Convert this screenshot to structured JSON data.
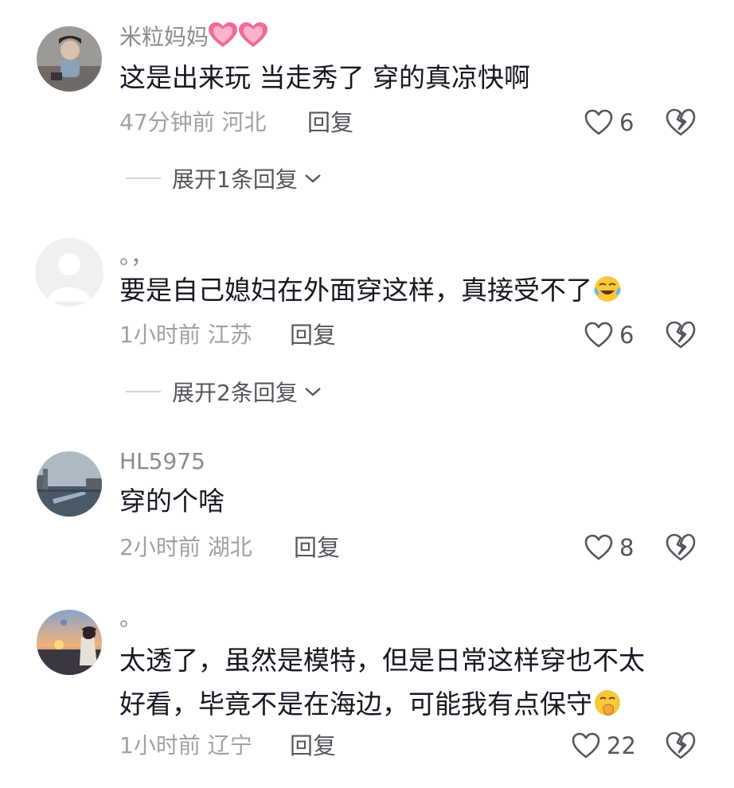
{
  "comments": [
    {
      "username": "米粒妈妈",
      "username_emoji": "pink-hearts",
      "text": "这是出来玩 当走秀了 穿的真凉快啊",
      "time": "47分钟前",
      "location": "河北",
      "reply_label": "回复",
      "likes": "6",
      "expand_label": "展开1条回复"
    },
    {
      "username": "。，",
      "text": "要是自己媳妇在外面穿这样，真接受不了",
      "text_emoji": "crying-laughing",
      "time": "1小时前",
      "location": "江苏",
      "reply_label": "回复",
      "likes": "6",
      "expand_label": "展开2条回复"
    },
    {
      "username": "HL5975",
      "text": "穿的个啥",
      "time": "2小时前",
      "location": "湖北",
      "reply_label": "回复",
      "likes": "8"
    },
    {
      "username": "。",
      "text_line1": "太透了，虽然是模特，但是日常这样穿也不太",
      "text_line2": "好看，毕竟不是在海边，可能我有点保守",
      "text_emoji": "hand-over-mouth",
      "time": "1小时前",
      "location": "辽宁",
      "reply_label": "回复",
      "likes": "22"
    }
  ],
  "colors": {
    "text": "#161823",
    "secondary": "#a0a1a6",
    "action": "#55565d",
    "heart_emoji": "#f06a9b"
  }
}
